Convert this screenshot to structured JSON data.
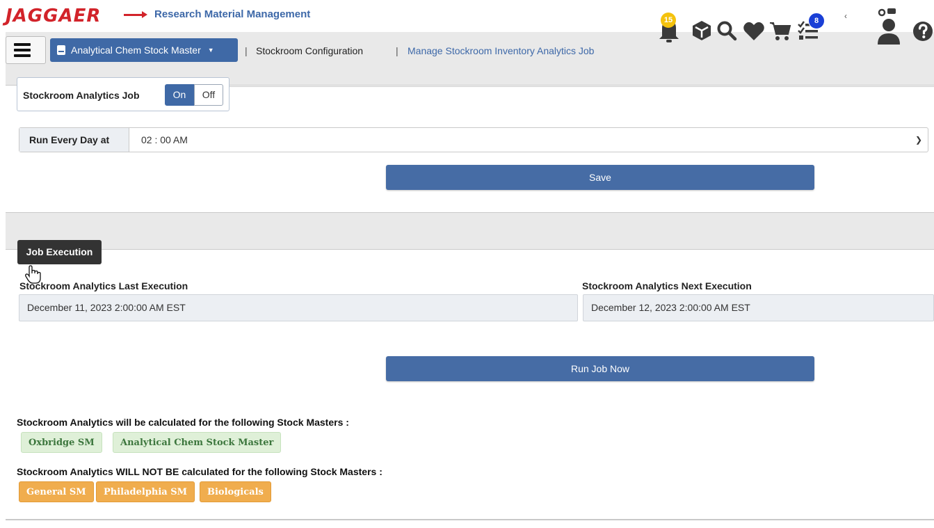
{
  "header": {
    "logo_text": "JAGGAER",
    "app_title": "Research Material Management",
    "stockmaster_dropdown": "Analytical Chem Stock Master",
    "breadcrumb": [
      {
        "label": "Stockroom Configuration"
      },
      {
        "label": "Manage Stockroom Inventory Analytics Job"
      }
    ],
    "separator": "|",
    "notifications_badge": "15",
    "tasks_badge": "8",
    "icons": [
      "hamburger-icon",
      "book-icon",
      "bell-icon",
      "cube-icon",
      "search-icon",
      "heart-icon",
      "cart-icon",
      "checklist-icon",
      "user-icon",
      "help-icon"
    ]
  },
  "analytics_job": {
    "label": "Stockroom Analytics Job",
    "on_label": "On",
    "off_label": "Off",
    "selected": "On"
  },
  "schedule": {
    "label": "Run Every Day at",
    "value": "02 : 00 AM"
  },
  "save_label": "Save",
  "job_execution": {
    "tooltip": "Job Execution",
    "last_label": "Stockroom Analytics Last Execution",
    "last_value": "December 11, 2023 2:00:00 AM EST",
    "next_label": "Stockroom Analytics Next Execution",
    "next_value": "December 12, 2023 2:00:00 AM EST",
    "run_now_label": "Run Job Now"
  },
  "stock_masters": {
    "included_title": "Stockroom Analytics will be calculated for the following Stock Masters :",
    "included": [
      "Oxbridge SM",
      "Analytical Chem Stock Master"
    ],
    "excluded_title": "Stockroom Analytics WILL NOT BE calculated for the following Stock Masters :",
    "excluded": [
      "General SM",
      "Philadelphia SM",
      "Biologicals"
    ]
  },
  "colors": {
    "primary": "#3f69a6",
    "brand_red": "#d2232a",
    "chip_included_bg": "#dff0d8",
    "chip_excluded_bg": "#f0ad4e",
    "badge_yellow": "#f4c20d",
    "badge_blue": "#1a3fd6"
  }
}
